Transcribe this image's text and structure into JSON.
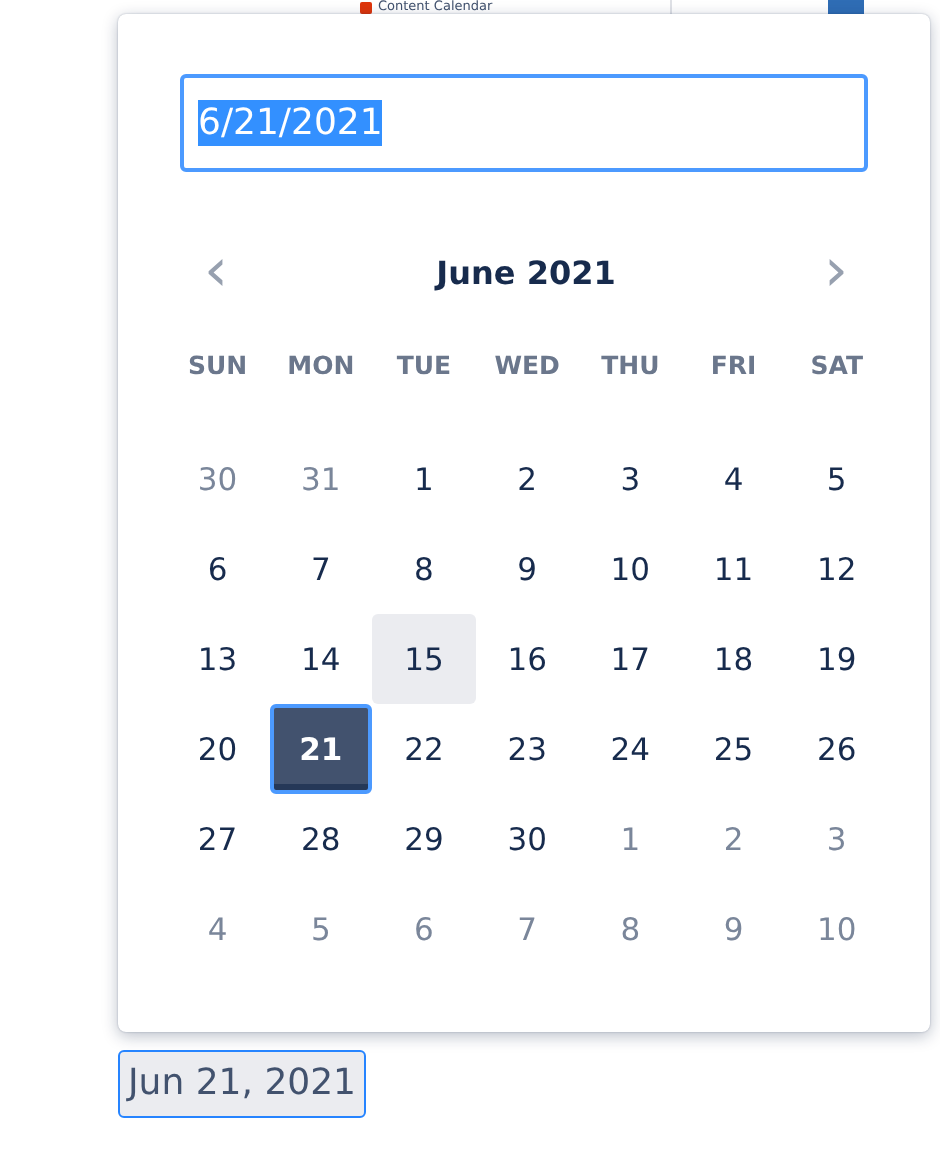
{
  "backdrop": {
    "tree_item": "Content Calendar"
  },
  "picker": {
    "input": {
      "value": "6/21/2021",
      "text_selected": true
    },
    "month_label": "June 2021",
    "prev": "‹",
    "next": "›",
    "weekdays": [
      "SUN",
      "MON",
      "TUE",
      "WED",
      "THU",
      "FRI",
      "SAT"
    ],
    "weeks": [
      [
        {
          "label": "30",
          "outside": true,
          "selected": false,
          "highlighted": false
        },
        {
          "label": "31",
          "outside": true,
          "selected": false,
          "highlighted": false
        },
        {
          "label": "1",
          "outside": false,
          "selected": false,
          "highlighted": false
        },
        {
          "label": "2",
          "outside": false,
          "selected": false,
          "highlighted": false
        },
        {
          "label": "3",
          "outside": false,
          "selected": false,
          "highlighted": false
        },
        {
          "label": "4",
          "outside": false,
          "selected": false,
          "highlighted": false
        },
        {
          "label": "5",
          "outside": false,
          "selected": false,
          "highlighted": false
        }
      ],
      [
        {
          "label": "6",
          "outside": false,
          "selected": false,
          "highlighted": false
        },
        {
          "label": "7",
          "outside": false,
          "selected": false,
          "highlighted": false
        },
        {
          "label": "8",
          "outside": false,
          "selected": false,
          "highlighted": false
        },
        {
          "label": "9",
          "outside": false,
          "selected": false,
          "highlighted": false
        },
        {
          "label": "10",
          "outside": false,
          "selected": false,
          "highlighted": false
        },
        {
          "label": "11",
          "outside": false,
          "selected": false,
          "highlighted": false
        },
        {
          "label": "12",
          "outside": false,
          "selected": false,
          "highlighted": false
        }
      ],
      [
        {
          "label": "13",
          "outside": false,
          "selected": false,
          "highlighted": false
        },
        {
          "label": "14",
          "outside": false,
          "selected": false,
          "highlighted": false
        },
        {
          "label": "15",
          "outside": false,
          "selected": false,
          "highlighted": true
        },
        {
          "label": "16",
          "outside": false,
          "selected": false,
          "highlighted": false
        },
        {
          "label": "17",
          "outside": false,
          "selected": false,
          "highlighted": false
        },
        {
          "label": "18",
          "outside": false,
          "selected": false,
          "highlighted": false
        },
        {
          "label": "19",
          "outside": false,
          "selected": false,
          "highlighted": false
        }
      ],
      [
        {
          "label": "20",
          "outside": false,
          "selected": false,
          "highlighted": false
        },
        {
          "label": "21",
          "outside": false,
          "selected": true,
          "highlighted": false
        },
        {
          "label": "22",
          "outside": false,
          "selected": false,
          "highlighted": false
        },
        {
          "label": "23",
          "outside": false,
          "selected": false,
          "highlighted": false
        },
        {
          "label": "24",
          "outside": false,
          "selected": false,
          "highlighted": false
        },
        {
          "label": "25",
          "outside": false,
          "selected": false,
          "highlighted": false
        },
        {
          "label": "26",
          "outside": false,
          "selected": false,
          "highlighted": false
        }
      ],
      [
        {
          "label": "27",
          "outside": false,
          "selected": false,
          "highlighted": false
        },
        {
          "label": "28",
          "outside": false,
          "selected": false,
          "highlighted": false
        },
        {
          "label": "29",
          "outside": false,
          "selected": false,
          "highlighted": false
        },
        {
          "label": "30",
          "outside": false,
          "selected": false,
          "highlighted": false
        },
        {
          "label": "1",
          "outside": true,
          "selected": false,
          "highlighted": false
        },
        {
          "label": "2",
          "outside": true,
          "selected": false,
          "highlighted": false
        },
        {
          "label": "3",
          "outside": true,
          "selected": false,
          "highlighted": false
        }
      ],
      [
        {
          "label": "4",
          "outside": true,
          "selected": false,
          "highlighted": false
        },
        {
          "label": "5",
          "outside": true,
          "selected": false,
          "highlighted": false
        },
        {
          "label": "6",
          "outside": true,
          "selected": false,
          "highlighted": false
        },
        {
          "label": "7",
          "outside": true,
          "selected": false,
          "highlighted": false
        },
        {
          "label": "8",
          "outside": true,
          "selected": false,
          "highlighted": false
        },
        {
          "label": "9",
          "outside": true,
          "selected": false,
          "highlighted": false
        },
        {
          "label": "10",
          "outside": true,
          "selected": false,
          "highlighted": false
        }
      ]
    ]
  },
  "trigger": {
    "label": "Jun 21, 2021"
  }
}
